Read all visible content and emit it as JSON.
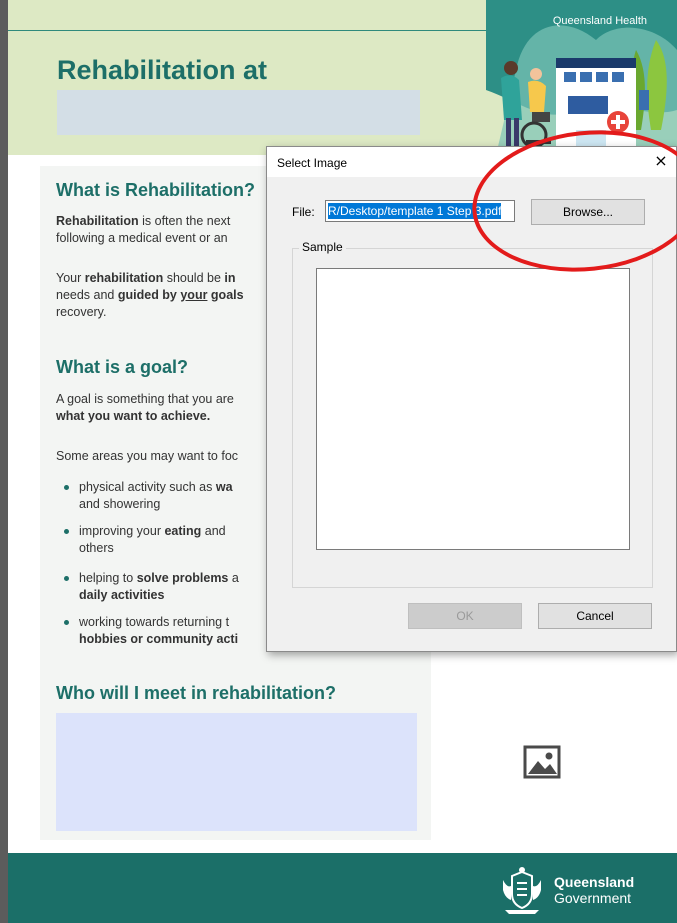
{
  "document": {
    "header_label": "Queensland Health",
    "title": "Rehabilitation at",
    "section1": {
      "heading": "What is Rehabilitation?",
      "p1_bold": "Rehabilitation",
      "p1_rest": " is often the next",
      "p1_line2": "following a medical event or an",
      "p2_a": "Your ",
      "p2_bold1": "rehabilitation",
      "p2_b": " should be ",
      "p2_bold2": "in",
      "p2_line2_a": "needs and ",
      "p2_line2_bold": "guided by ",
      "p2_line2_u": "your",
      "p2_line2_bold2": " goals",
      "p2_line3": "recovery."
    },
    "section2": {
      "heading": "What is a goal?",
      "p1": "A goal is something that you are",
      "p1_line2": "what you want to achieve.",
      "p2": "Some areas you may want to foc",
      "bullets": [
        {
          "line1_a": "physical activity such as ",
          "line1_bold": "wa",
          "line2": "and showering"
        },
        {
          "line1_a": "improving your ",
          "line1_bold": "eating",
          "line1_b": " and ",
          "line2": "others"
        },
        {
          "line1_a": "helping to ",
          "line1_bold": "solve problems",
          "line1_b": " a",
          "line2": "daily activities"
        },
        {
          "line1_a": "working towards returning t",
          "line2": "hobbies or community acti"
        }
      ]
    },
    "section3": {
      "heading": "Who will I meet in rehabilitation?"
    },
    "footer": {
      "line1": "Queensland",
      "line2": "Government"
    }
  },
  "dialog": {
    "title": "Select Image",
    "close_glyph": "×",
    "file_label": "File:",
    "file_value": "R/Desktop/template 1 Step 3.pdf",
    "browse_label": "Browse...",
    "sample_label": "Sample",
    "ok_label": "OK",
    "cancel_label": "Cancel"
  },
  "colors": {
    "brand_teal": "#1d6f68",
    "header_green": "#dde9c4",
    "annotation_red": "#e31b1b",
    "selection_blue": "#0078d7"
  },
  "icons": [
    "image-placeholder-icon",
    "close-icon",
    "queensland-crest-icon",
    "hospital-illustration"
  ]
}
